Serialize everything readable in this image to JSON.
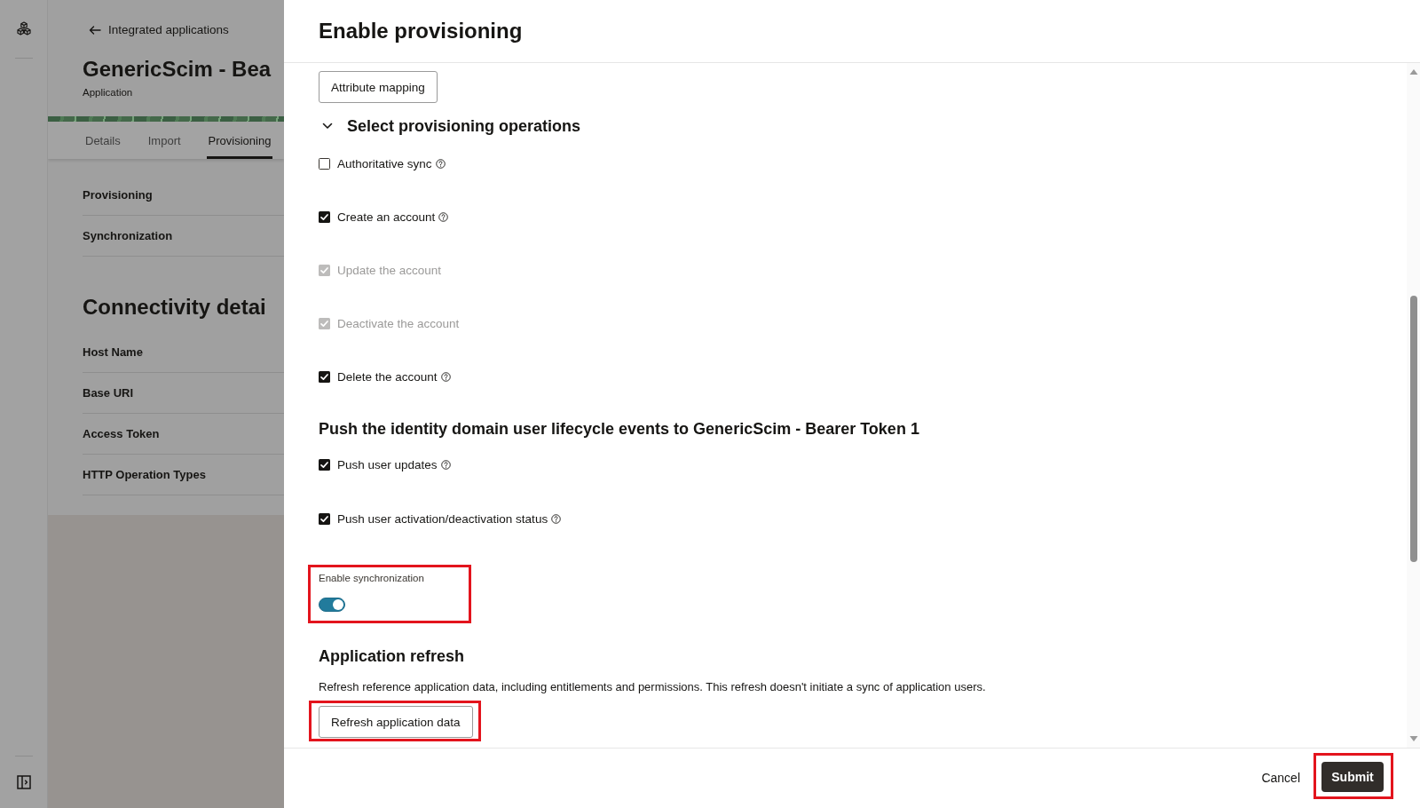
{
  "background_page": {
    "back_link": "Integrated applications",
    "title": "GenericScim - Bea",
    "subtitle": "Application",
    "tabs": [
      {
        "label": "Details",
        "selected": false
      },
      {
        "label": "Import",
        "selected": false
      },
      {
        "label": "Provisioning",
        "selected": true
      }
    ],
    "settings": [
      "Provisioning",
      "Synchronization"
    ],
    "section_title": "Connectivity detai",
    "fields": [
      "Host Name",
      "Base URI",
      "Access Token",
      "HTTP Operation Types"
    ]
  },
  "drawer": {
    "title": "Enable provisioning",
    "attribute_mapping_button": "Attribute mapping",
    "operations": {
      "title": "Select provisioning operations",
      "expanded": true,
      "options": [
        {
          "label": "Authoritative sync",
          "checked": false,
          "disabled": false,
          "help": true
        },
        {
          "label": "Create an account",
          "checked": true,
          "disabled": false,
          "help": true
        },
        {
          "label": "Update the account",
          "checked": true,
          "disabled": true,
          "help": false
        },
        {
          "label": "Deactivate the account",
          "checked": true,
          "disabled": true,
          "help": false
        },
        {
          "label": "Delete the account",
          "checked": true,
          "disabled": false,
          "help": true
        }
      ]
    },
    "push_events": {
      "title": "Push the identity domain user lifecycle events to GenericScim - Bearer Token 1",
      "options": [
        {
          "label": "Push user updates",
          "checked": true,
          "disabled": false,
          "help": true
        },
        {
          "label": "Push user activation/deactivation status",
          "checked": true,
          "disabled": false,
          "help": true
        }
      ]
    },
    "sync": {
      "label": "Enable synchronization",
      "on": true,
      "highlighted": true
    },
    "refresh": {
      "title": "Application refresh",
      "description": "Refresh reference application data, including entitlements and permissions. This refresh doesn't initiate a sync of application users.",
      "button": {
        "label": "Refresh application data",
        "highlighted": true
      }
    },
    "footer": {
      "cancel": "Cancel",
      "submit": {
        "label": "Submit",
        "highlighted": true
      }
    }
  }
}
